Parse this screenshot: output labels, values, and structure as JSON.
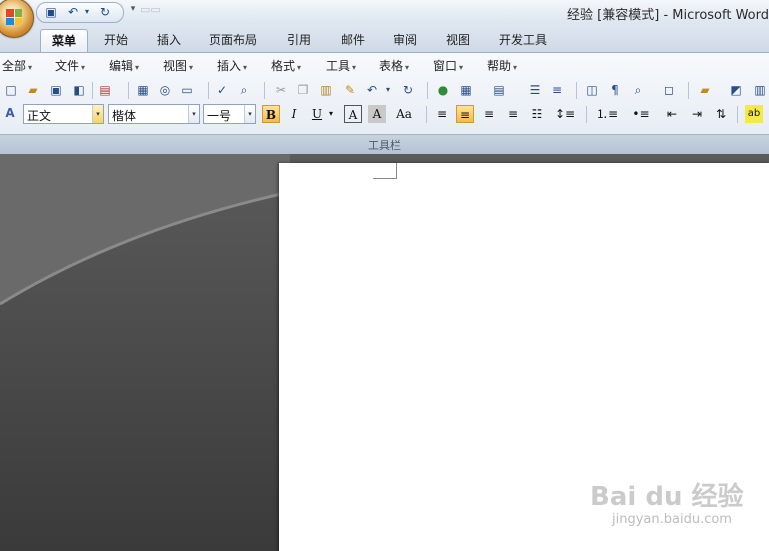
{
  "window": {
    "title": "经验 [兼容模式] - Microsoft Word"
  },
  "qat": {
    "icons": [
      "save-icon",
      "undo-icon",
      "redo-icon"
    ]
  },
  "tabs": [
    "菜单",
    "开始",
    "插入",
    "页面布局",
    "引用",
    "邮件",
    "审阅",
    "视图",
    "开发工具"
  ],
  "active_tab": "菜单",
  "menu": [
    "全部",
    "文件",
    "编辑",
    "视图",
    "插入",
    "格式",
    "工具",
    "表格",
    "窗口",
    "帮助"
  ],
  "format": {
    "style": "正文",
    "font": "楷体",
    "size": "一号",
    "bold": "B",
    "italic": "I",
    "underline": "U",
    "char_border": "A",
    "char_shade": "A",
    "change_case": "Aa"
  },
  "group_label": "工具栏",
  "watermark": {
    "main": "Bai du 经验",
    "sub": "jingyan.baidu.com"
  },
  "colors": {
    "accent": "#f7b84b",
    "ribbon": "#e7edf4",
    "workspace": "#4a4a4a"
  }
}
